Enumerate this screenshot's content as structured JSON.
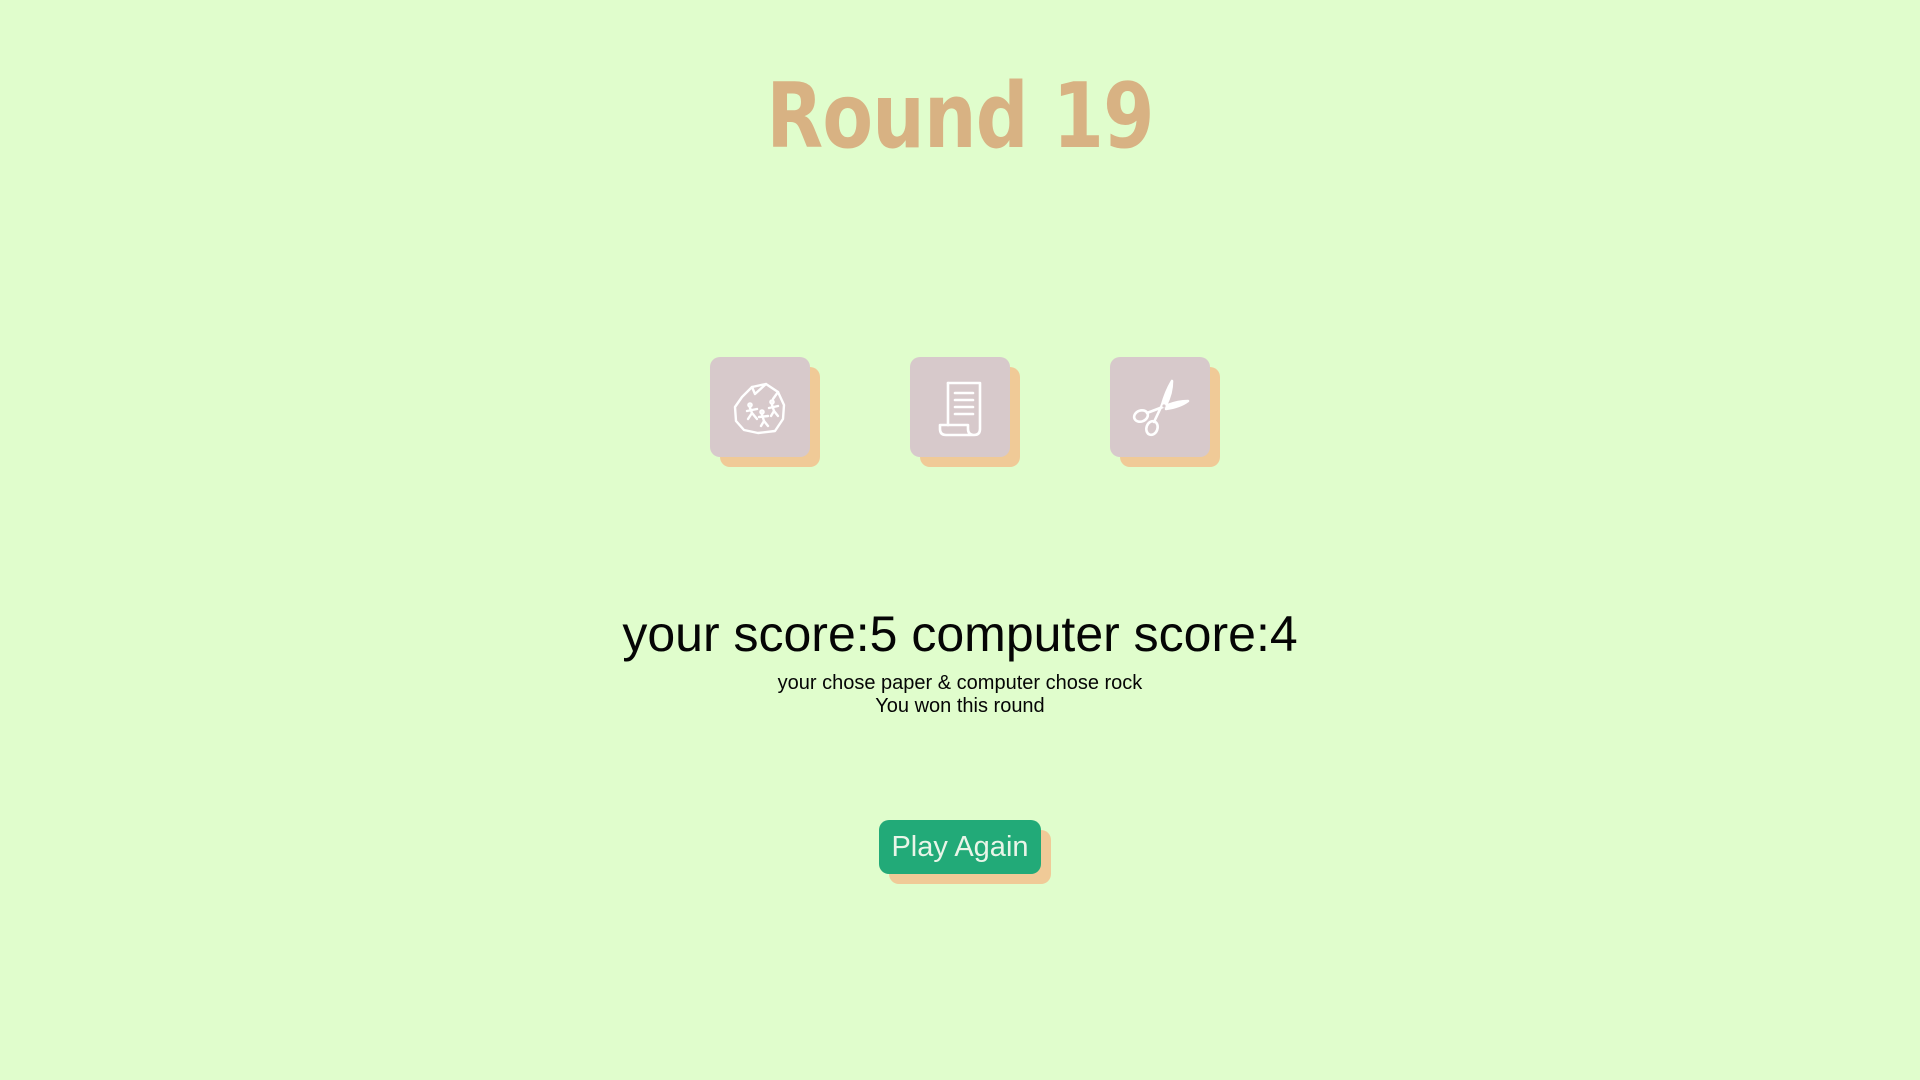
{
  "game": {
    "title": "Round 19",
    "choices": [
      {
        "id": "rock",
        "icon": "rock-icon"
      },
      {
        "id": "paper",
        "icon": "paper-scroll-icon"
      },
      {
        "id": "scissors",
        "icon": "scissors-icon"
      }
    ],
    "score_line": "your score:5 computer score:4",
    "your_score": 5,
    "computer_score": 4,
    "result_detail": "your chose paper & computer chose rock",
    "result_message": "You won this round",
    "play_again_label": "Play Again"
  },
  "colors": {
    "background": "#e0fdcc",
    "title": "#d8b283",
    "tile": "#d7c9cb",
    "tile_shadow": "#f0ca97",
    "button": "#22aa78",
    "button_text": "#e9f5e8"
  }
}
